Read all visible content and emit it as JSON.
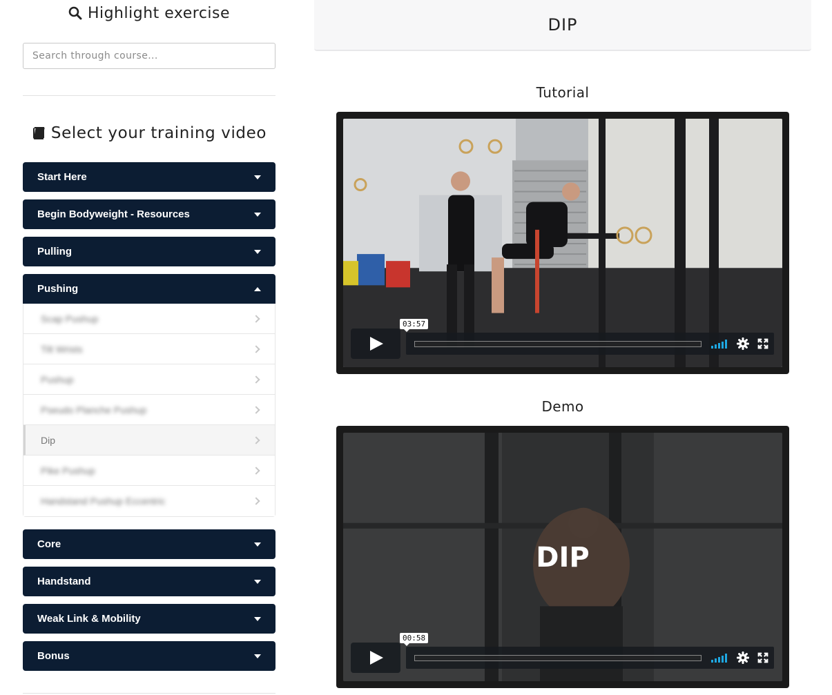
{
  "sidebar": {
    "highlight_title": "Highlight exercise",
    "search_placeholder": "Search through course...",
    "select_title": "Select your training video",
    "sections": [
      {
        "label": "Start Here",
        "open": false
      },
      {
        "label": "Begin Bodyweight - Resources",
        "open": false
      },
      {
        "label": "Pulling",
        "open": false
      },
      {
        "label": "Pushing",
        "open": true,
        "items": [
          {
            "label": "Scap Pushup",
            "blurred": true
          },
          {
            "label": "Tilt Wrists",
            "blurred": true
          },
          {
            "label": "Pushup",
            "blurred": true
          },
          {
            "label": "Pseudo Planche Pushup",
            "blurred": true
          },
          {
            "label": "Dip",
            "blurred": false,
            "active": true
          },
          {
            "label": "Pike Pushup",
            "blurred": true
          },
          {
            "label": "Handstand Pushup Eccentric",
            "blurred": true
          }
        ]
      },
      {
        "label": "Core",
        "open": false
      },
      {
        "label": "Handstand",
        "open": false
      },
      {
        "label": "Weak Link & Mobility",
        "open": false
      },
      {
        "label": "Bonus",
        "open": false
      }
    ]
  },
  "main": {
    "title": "DIP",
    "videos": [
      {
        "label": "Tutorial",
        "duration": "03:57"
      },
      {
        "label": "Demo",
        "duration": "00:58",
        "overlay_text": "DIP"
      }
    ]
  },
  "icons": {
    "search": "search-icon",
    "book": "book-icon",
    "caret": "caret-down-icon",
    "chevron": "chevron-right-icon",
    "play": "play-icon",
    "volume": "volume-icon",
    "settings": "gear-icon",
    "fullscreen": "fullscreen-icon"
  },
  "colors": {
    "accordion_header": "#0c1d33",
    "volume_accent": "#1ea7e1"
  }
}
